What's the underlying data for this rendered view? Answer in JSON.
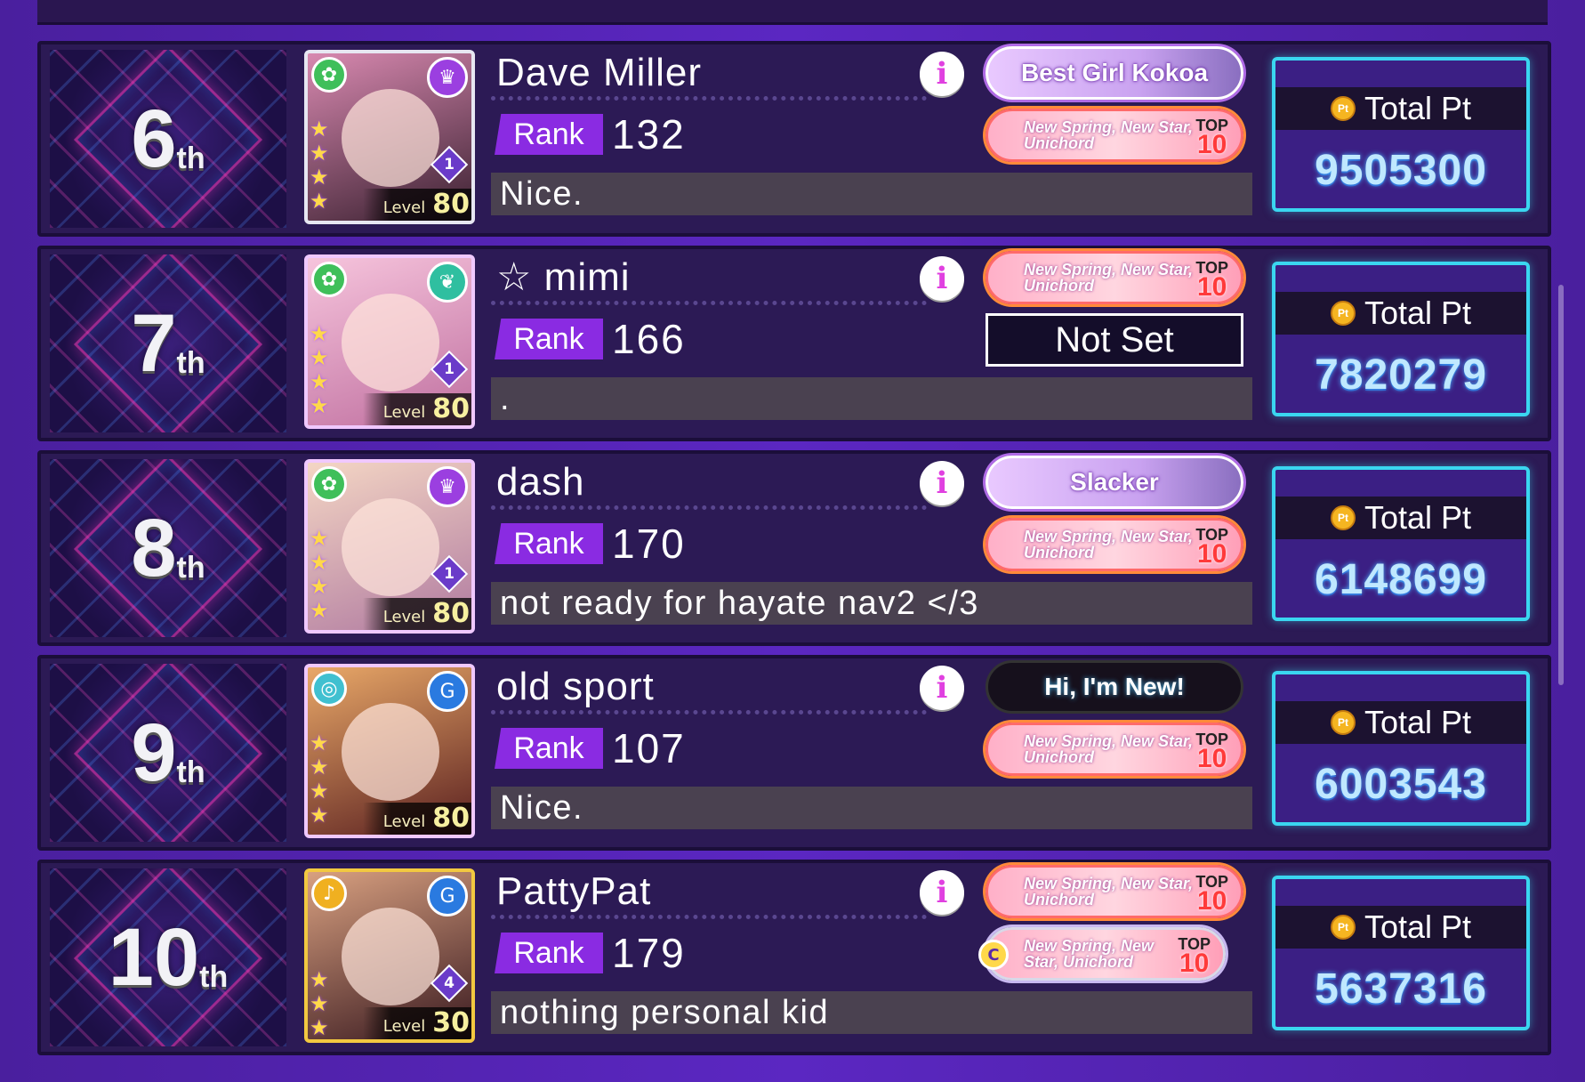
{
  "colors": {
    "background": "#5b27c2",
    "row_bg": "#2c1a55",
    "rank_badge": "#8a2be2",
    "pt_border": "#3ad6f0",
    "pt_value": "#bfe8ff"
  },
  "total_pt_label": "Total Pt",
  "rank_label": "Rank",
  "level_label": "Level",
  "rows": [
    {
      "place": "6",
      "suffix": "th",
      "name": "Dave Miller",
      "rank": "132",
      "comment": "Nice.",
      "level": "80",
      "card_train": "1",
      "title1": {
        "text": "Best Girl Kokoa",
        "style": "purple"
      },
      "title2": {
        "event": "New Spring, New Star, Unichord",
        "top_label": "TOP",
        "top_value": "10",
        "style": "event"
      },
      "total_pt": "9505300",
      "card_colors": [
        "#b0608a",
        "#3a2030"
      ]
    },
    {
      "place": "7",
      "suffix": "th",
      "name": "☆ mimi",
      "rank": "166",
      "comment": ".",
      "level": "80",
      "card_train": "1",
      "title1": {
        "event": "New Spring, New Star, Unichord",
        "top_label": "TOP",
        "top_value": "10",
        "style": "event"
      },
      "title2": {
        "text": "Not Set",
        "style": "notset"
      },
      "total_pt": "7820279",
      "card_colors": [
        "#f0b0d0",
        "#c070a0"
      ]
    },
    {
      "place": "8",
      "suffix": "th",
      "name": "dash",
      "rank": "170",
      "comment": "not ready for hayate nav2 </3",
      "level": "80",
      "card_train": "1",
      "title1": {
        "text": "Slacker",
        "style": "purple"
      },
      "title2": {
        "event": "New Spring, New Star, Unichord",
        "top_label": "TOP",
        "top_value": "10",
        "style": "event"
      },
      "total_pt": "6148699",
      "card_colors": [
        "#f0c8b0",
        "#b07aa0"
      ]
    },
    {
      "place": "9",
      "suffix": "th",
      "name": "old sport",
      "rank": "107",
      "comment": "Nice.",
      "level": "80",
      "card_train": "",
      "title1": {
        "text": "Hi, I'm New!",
        "style": "dark"
      },
      "title2": {
        "event": "New Spring, New Star, Unichord",
        "top_label": "TOP",
        "top_value": "10",
        "style": "event"
      },
      "total_pt": "6003543",
      "card_colors": [
        "#e0a060",
        "#5a2020"
      ]
    },
    {
      "place": "10",
      "suffix": "th",
      "name": "PattyPat",
      "rank": "179",
      "comment": "nothing personal kid",
      "level": "30",
      "card_train": "4",
      "title1": {
        "event": "New Spring, New Star, Unichord",
        "top_label": "TOP",
        "top_value": "10",
        "style": "event"
      },
      "title2": {
        "event": "New Spring, New Star, Unichord",
        "top_label": "TOP",
        "top_value": "10",
        "style": "event",
        "badge": "C"
      },
      "total_pt": "5637316",
      "card_colors": [
        "#c89070",
        "#3a1a20"
      ]
    }
  ]
}
